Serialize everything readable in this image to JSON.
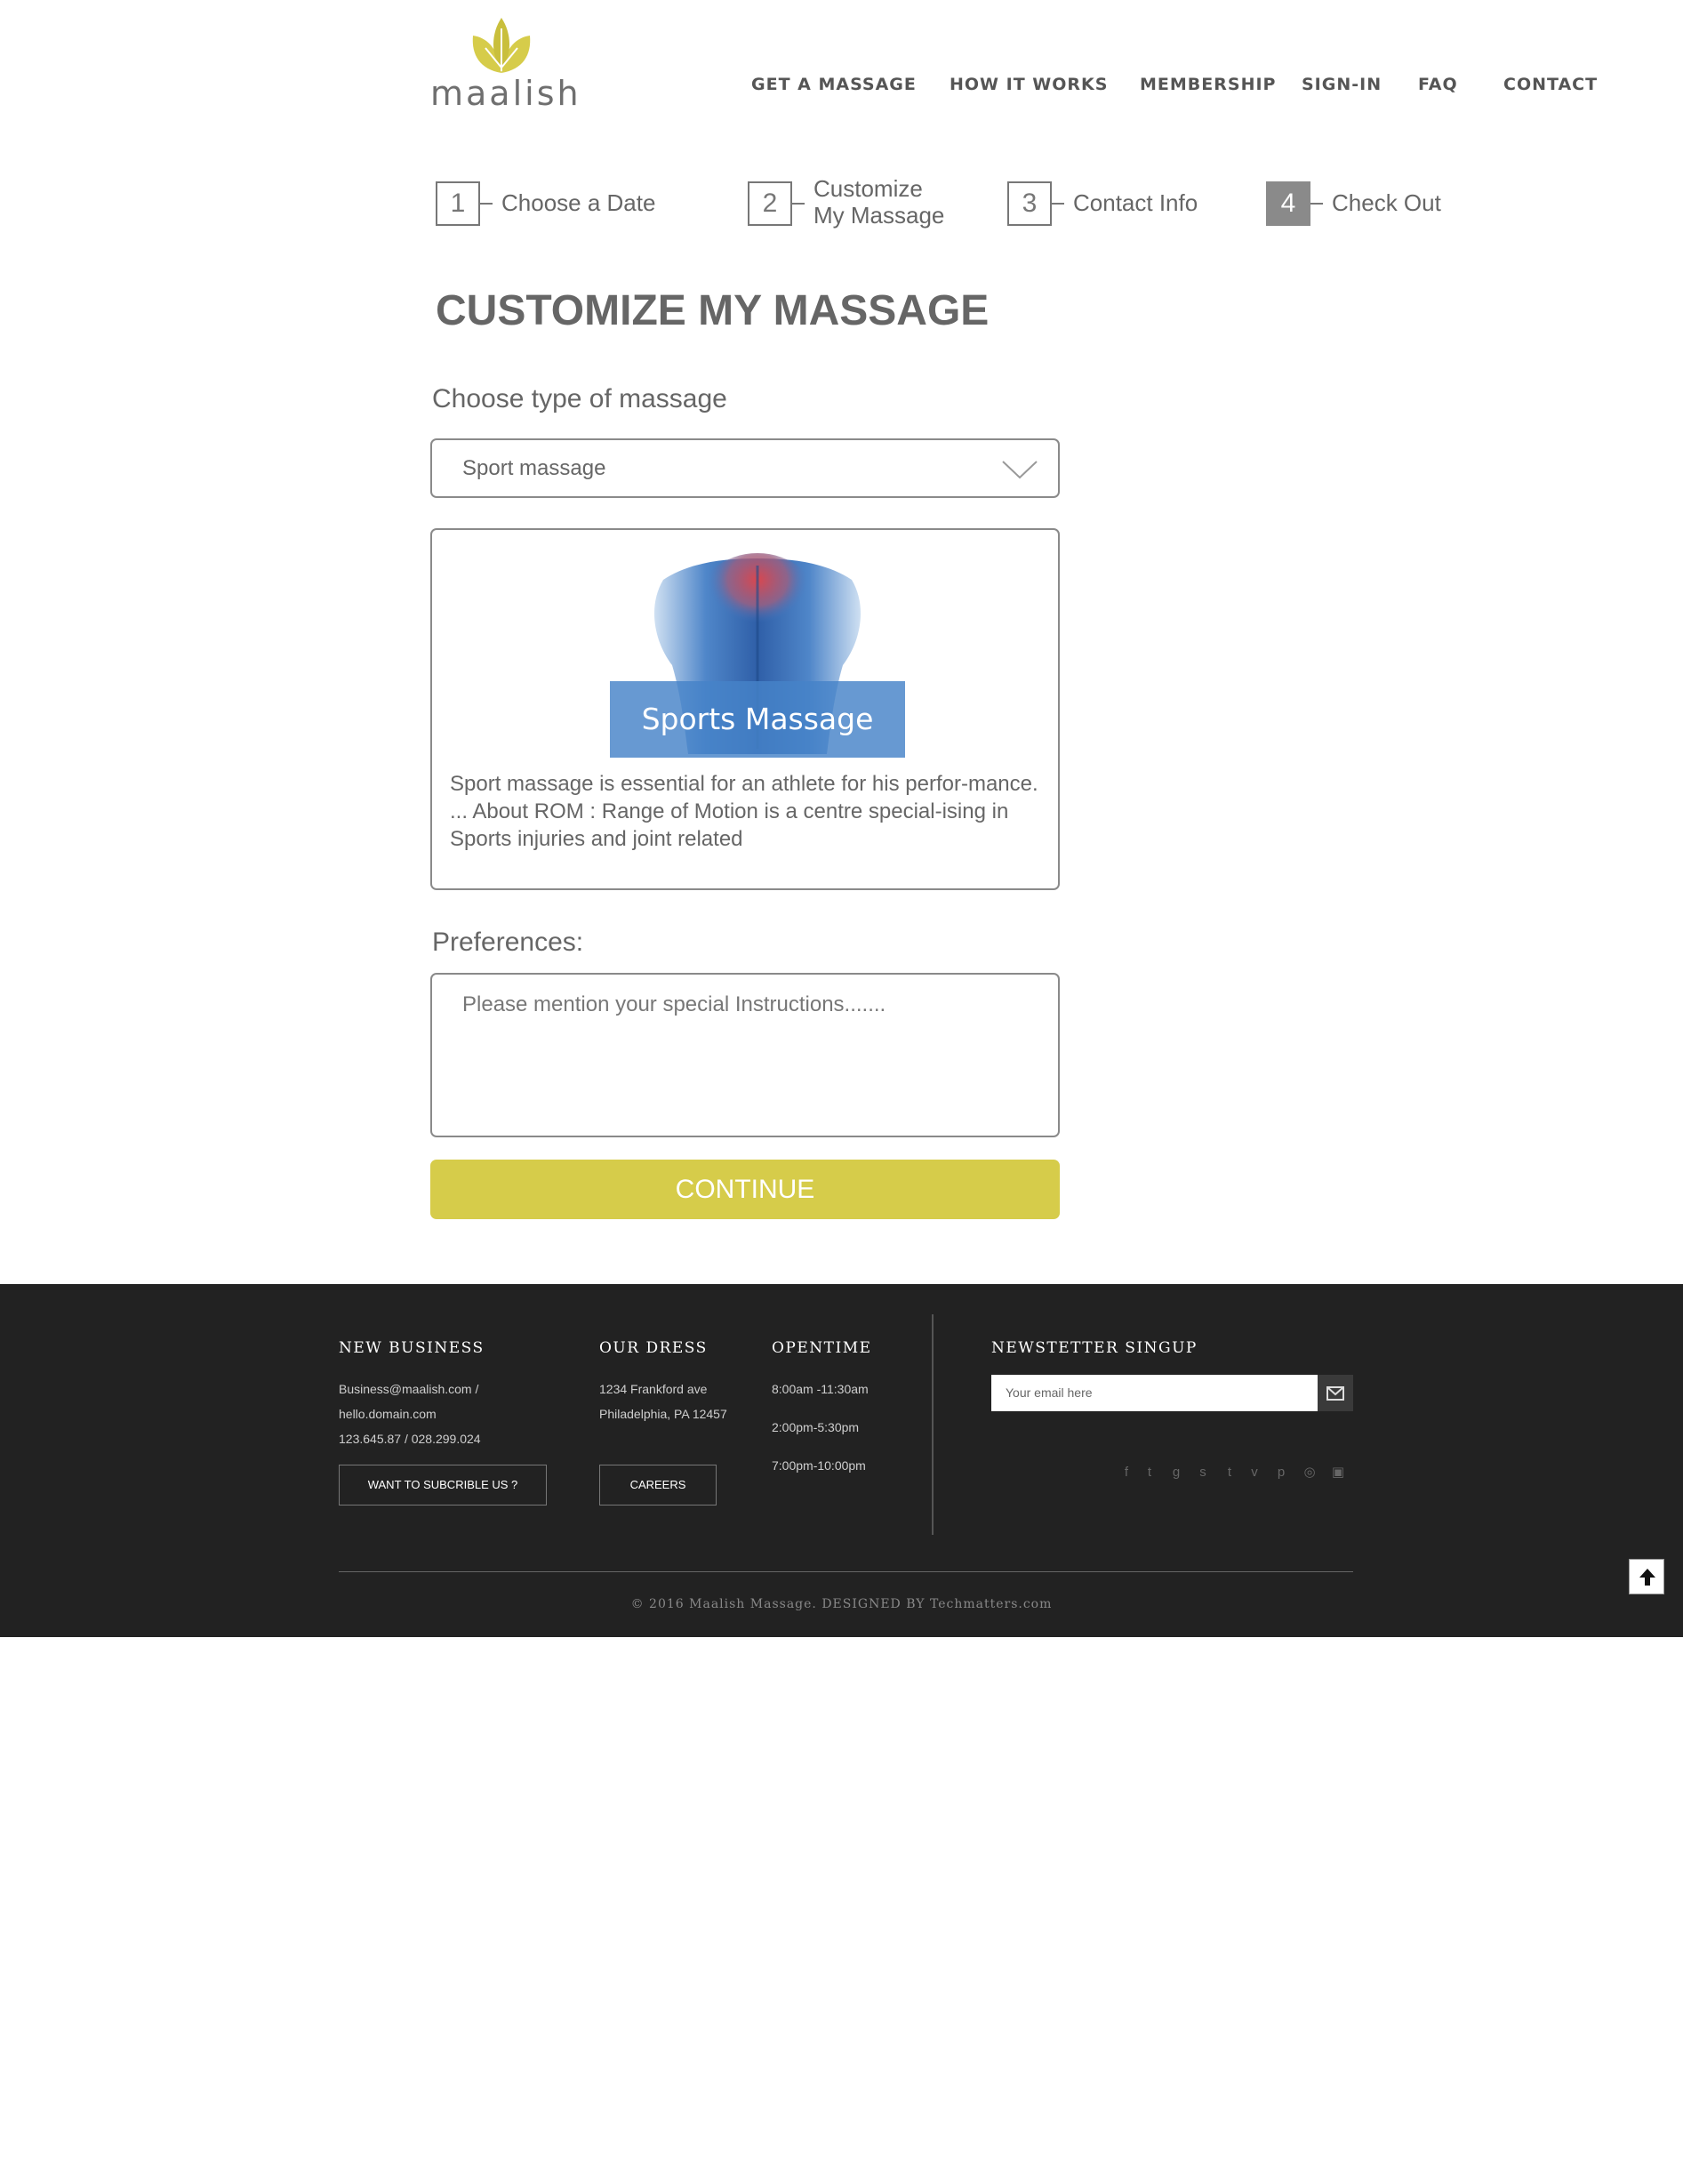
{
  "brand": {
    "logo_text": "maalish",
    "accent": "#d6cc4a"
  },
  "nav": [
    {
      "label": "GET A MASSAGE"
    },
    {
      "label": "HOW IT WORKS"
    },
    {
      "label": "MEMBERSHIP"
    },
    {
      "label": "SIGN-IN"
    },
    {
      "label": "FAQ"
    },
    {
      "label": "CONTACT"
    }
  ],
  "steps": [
    {
      "number": "1",
      "label_line1": "Choose a Date",
      "label_line2": ""
    },
    {
      "number": "2",
      "label_line1": "Customize",
      "label_line2": "My Massage"
    },
    {
      "number": "3",
      "label_line1": "Contact Info",
      "label_line2": ""
    },
    {
      "number": "4",
      "label_line1": "Check Out",
      "label_line2": "",
      "active": true
    }
  ],
  "page": {
    "title": "CUSTOMIZE MY MASSAGE",
    "type_label": "Choose type of massage",
    "type_selected": "Sport massage",
    "card_caption": "Sports Massage",
    "card_description": "Sport massage is essential for an athlete for his perfor-mance. ... About ROM : Range of Motion is a centre special-ising in Sports injuries and joint related",
    "preferences_label": "Preferences:",
    "preferences_placeholder": "Please mention your special Instructions.......",
    "continue_label": "CONTINUE"
  },
  "footer": {
    "col1": {
      "heading": "NEW BUSINESS",
      "line1": "Business@maalish.com /",
      "line2": "hello.domain.com",
      "line3": "123.645.87 / 028.299.024",
      "button": "WANT TO SUBCRIBLE US ?"
    },
    "col2": {
      "heading": "OUR DRESS",
      "line1": "1234 Frankford ave",
      "line2": "Philadelphia, PA 12457",
      "button": "CAREERS"
    },
    "col3": {
      "heading": "OPENTIME",
      "line1": "8:00am -11:30am",
      "line2": "2:00pm-5:30pm",
      "line3": "7:00pm-10:00pm"
    },
    "newsletter": {
      "heading": "NEWSTETTER SINGUP",
      "placeholder": "Your email here"
    },
    "socials": [
      "facebook-icon",
      "twitter-icon",
      "google-plus-icon",
      "stumbleupon-icon",
      "tumblr-icon",
      "vimeo-icon",
      "pinterest-icon",
      "dribbble-icon",
      "instagram-icon"
    ],
    "copyright": "© 2016 Maalish Massage. DESIGNED BY Techmatters.com"
  }
}
